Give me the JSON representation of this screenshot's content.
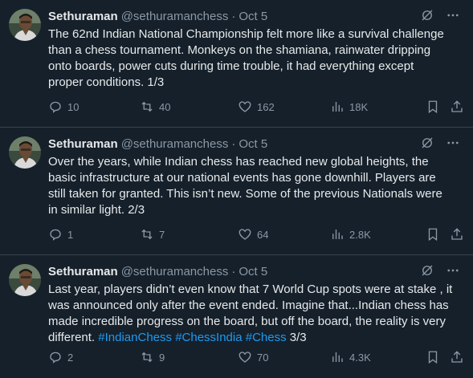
{
  "tweets": [
    {
      "name": "Sethuraman",
      "handle": "@sethuramanchess",
      "sep": "·",
      "date": "Oct 5",
      "lines": [
        "The 62nd Indian National Championship felt more like a survival challenge",
        "than a chess tournament. Monkeys on the shamiana, rainwater dripping",
        "onto boards, power cuts during time trouble, it had everything except",
        "proper conditions. 1/3"
      ],
      "replies": "10",
      "reposts": "40",
      "likes": "162",
      "views": "18K"
    },
    {
      "name": "Sethuraman",
      "handle": "@sethuramanchess",
      "sep": "·",
      "date": "Oct 5",
      "lines": [
        "Over the years, while Indian chess has reached new global heights, the",
        "basic infrastructure at our national events has gone downhill. Players are",
        "still taken for granted. This isn’t new. Some of the previous Nationals were",
        "in similar light. 2/3"
      ],
      "replies": "1",
      "reposts": "7",
      "likes": "64",
      "views": "2.8K"
    },
    {
      "name": "Sethuraman",
      "handle": "@sethuramanchess",
      "sep": "·",
      "date": "Oct 5",
      "lines": [
        "Last year, players didn’t even know that 7 World Cup spots were at stake , it",
        "was announced only after the event ended. Imagine that...Indian chess has",
        "made incredible progress on the board, but off the board, the reality is very"
      ],
      "last_line_start": "different.",
      "hashtags": [
        "#IndianChess",
        "#ChessIndia",
        "#Chess"
      ],
      "last_line_end": "3/3",
      "replies": "2",
      "reposts": "9",
      "likes": "70",
      "views": "4.3K"
    }
  ],
  "colors": {
    "background": "#15202b",
    "text": "#e7e9ea",
    "muted": "#8b98a5",
    "link": "#1d9bf0",
    "divider": "#38444d"
  }
}
